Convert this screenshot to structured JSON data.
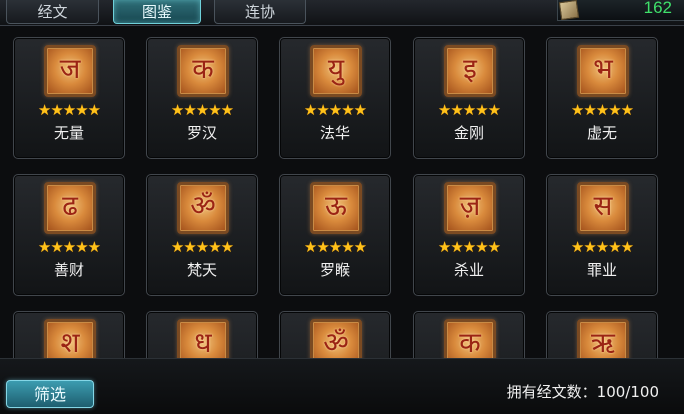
{
  "tabs": [
    {
      "label": "经文",
      "active": false
    },
    {
      "label": "图鉴",
      "active": true
    },
    {
      "label": "连协",
      "active": false
    }
  ],
  "currency": {
    "icon": "scroll-icon",
    "value": "162",
    "color": "#3fe06a"
  },
  "cards": [
    {
      "name": "无量",
      "glyph": "ज",
      "stars": "★★★★★"
    },
    {
      "name": "罗汉",
      "glyph": "क",
      "stars": "★★★★★"
    },
    {
      "name": "法华",
      "glyph": "यु",
      "stars": "★★★★★"
    },
    {
      "name": "金刚",
      "glyph": "इ",
      "stars": "★★★★★"
    },
    {
      "name": "虚无",
      "glyph": "भ",
      "stars": "★★★★★"
    },
    {
      "name": "善财",
      "glyph": "ढ",
      "stars": "★★★★★"
    },
    {
      "name": "梵天",
      "glyph": "ॐ",
      "stars": "★★★★★"
    },
    {
      "name": "罗睺",
      "glyph": "ऊ",
      "stars": "★★★★★"
    },
    {
      "name": "杀业",
      "glyph": "ज़",
      "stars": "★★★★★"
    },
    {
      "name": "罪业",
      "glyph": "स",
      "stars": "★★★★★"
    },
    {
      "name": "",
      "glyph": "श",
      "stars": ""
    },
    {
      "name": "",
      "glyph": "ध",
      "stars": ""
    },
    {
      "name": "",
      "glyph": "ॐ",
      "stars": ""
    },
    {
      "name": "",
      "glyph": "क",
      "stars": ""
    },
    {
      "name": "",
      "glyph": "ऋ",
      "stars": ""
    }
  ],
  "bottom": {
    "filter_label": "筛选",
    "owned_text": "拥有经文数：100/100"
  },
  "colors": {
    "accent": "#6fd1da",
    "star": "#ffc21a",
    "emblem": "#d98a3c"
  }
}
